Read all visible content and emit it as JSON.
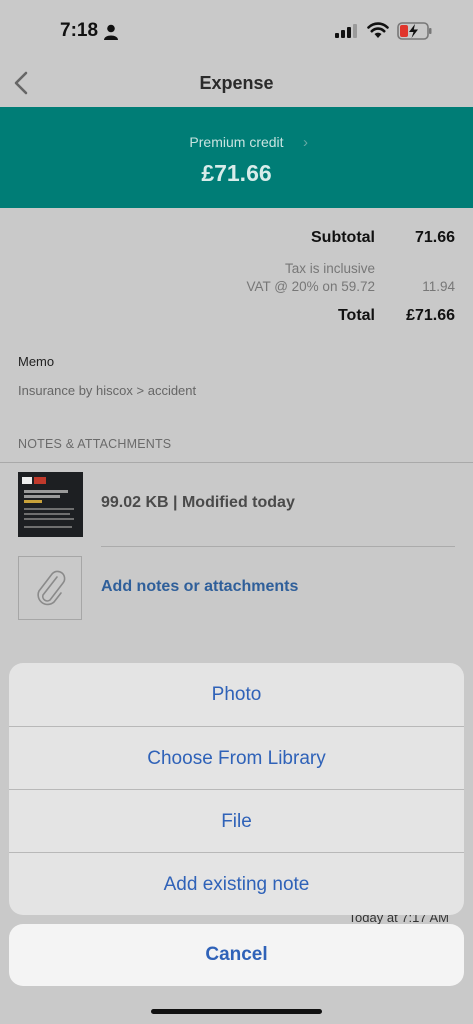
{
  "status": {
    "time": "7:18"
  },
  "nav": {
    "title": "Expense"
  },
  "banner": {
    "label": "Premium credit",
    "amount": "£71.66",
    "color": "#007d76"
  },
  "totals": {
    "subtotal_label": "Subtotal",
    "subtotal_value": "71.66",
    "tax_note": "Tax is inclusive",
    "vat_label": "VAT @ 20% on 59.72",
    "vat_value": "11.94",
    "total_label": "Total",
    "total_value": "£71.66"
  },
  "memo": {
    "label": "Memo",
    "value": "Insurance by hiscox > accident"
  },
  "attachments": {
    "header": "NOTES & ATTACHMENTS",
    "item_text": "99.02 KB | Modified today",
    "add_label": "Add notes or attachments"
  },
  "background": {
    "timestamp": "Today at 7:17 AM"
  },
  "action_sheet": {
    "items": [
      "Photo",
      "Choose From Library",
      "File",
      "Add existing note"
    ],
    "cancel": "Cancel"
  },
  "colors": {
    "link": "#2f62b8",
    "accent": "#007d76"
  }
}
